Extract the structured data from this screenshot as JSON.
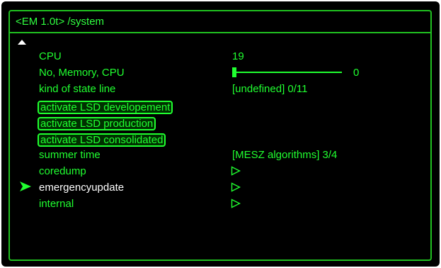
{
  "header": {
    "path": "<EM 1.0t>  /system"
  },
  "menu": {
    "cpu": {
      "label": "CPU",
      "value": "19"
    },
    "no_memory_cpu": {
      "label": "No, Memory, CPU",
      "value": "0",
      "slider_fraction": 0.0
    },
    "kind_of_state_line": {
      "label": "kind of state line",
      "value": "[undefined] 0/11"
    },
    "activate_dev": {
      "label": "activate LSD developement"
    },
    "activate_prod": {
      "label": "activate LSD production"
    },
    "activate_cons": {
      "label": "activate LSD consolidated"
    },
    "summer_time": {
      "label": "summer time",
      "value": "[MESZ algorithms] 3/4"
    },
    "coredump": {
      "label": "coredump"
    },
    "emergencyupdate": {
      "label": "emergencyupdate"
    },
    "internal": {
      "label": "internal"
    }
  },
  "icons": {
    "scroll": "scroll-up-icon",
    "cursor": "selection-arrow-icon",
    "submenu": "play-outline-icon"
  },
  "colors": {
    "accent": "#20ff30",
    "selected": "#ffffff",
    "frame": "#20c020",
    "background": "#000000"
  }
}
